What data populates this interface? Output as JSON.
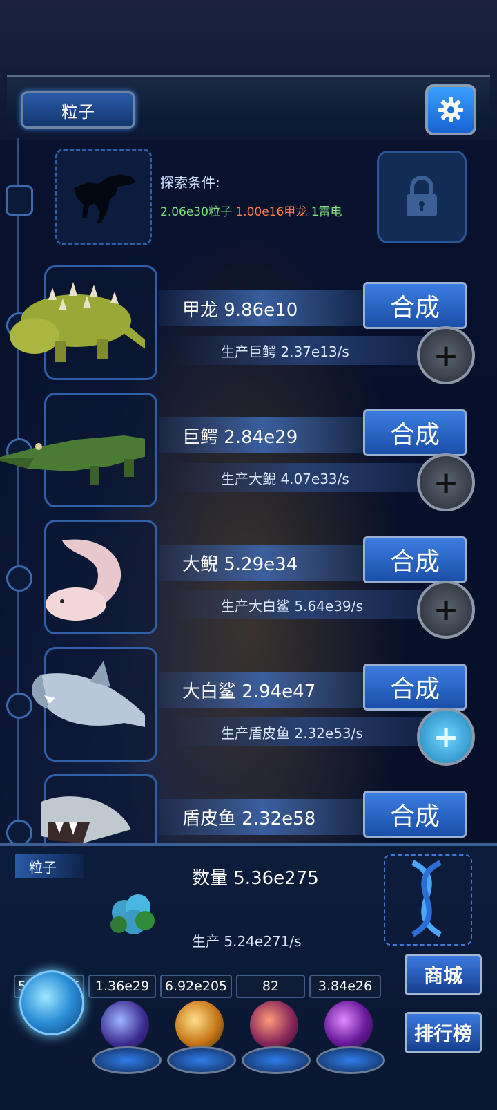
{
  "header": {
    "tab_label": "粒子",
    "settings_icon": "gear-icon"
  },
  "explore": {
    "label": "探索条件:",
    "req_particles": "2.06e30粒子",
    "req_ankylosaur": "1.00e16甲龙",
    "req_thunder": "1雷电"
  },
  "creatures": [
    {
      "name_line": "甲龙 9.86e10",
      "prod_line": "生产巨鳄 2.37e13/s",
      "merge_label": "合成",
      "plus_active": false
    },
    {
      "name_line": "巨鳄 2.84e29",
      "prod_line": "生产大鲵 4.07e33/s",
      "merge_label": "合成",
      "plus_active": false
    },
    {
      "name_line": "大鲵 5.29e34",
      "prod_line": "生产大白鲨 5.64e39/s",
      "merge_label": "合成",
      "plus_active": false
    },
    {
      "name_line": "大白鲨 2.94e47",
      "prod_line": "生产盾皮鱼 2.32e53/s",
      "merge_label": "合成",
      "plus_active": true
    },
    {
      "name_line": "盾皮鱼 2.32e58",
      "prod_line": "",
      "merge_label": "合成",
      "plus_active": false
    }
  ],
  "particle_panel": {
    "label": "粒子",
    "count_line": "数量 5.36e275",
    "prod_line": "生产 5.24e271/s"
  },
  "resources": [
    "5.36e275",
    "1.36e29",
    "6.92e205",
    "82",
    "3.84e26"
  ],
  "side_buttons": {
    "shop": "商城",
    "ranking": "排行榜"
  },
  "colors": {
    "accent": "#2a6fd6",
    "req_green": "#7ee07e",
    "req_orange": "#ff7a4d"
  }
}
